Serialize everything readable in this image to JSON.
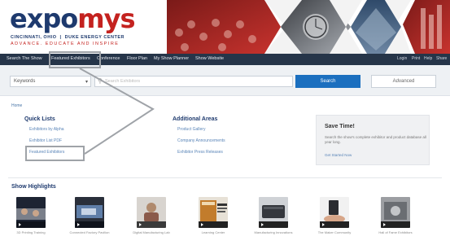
{
  "header": {
    "logo_part1": "expo",
    "logo_part2": "mys",
    "tagline_left": "CINCINNATI, OHIO",
    "tagline_right": "DUKE ENERGY CENTER",
    "tagline_sub": "ADVANCE. EDUCATE AND INSPIRE",
    "banner_image": "city-photo-collage"
  },
  "nav": {
    "items": [
      "Search The Show",
      "Featured Exhibitors",
      "Conference",
      "Floor Plan",
      "My Show Planner",
      "Show Website"
    ],
    "utility": [
      "Login",
      "Print",
      "Help",
      "Share"
    ]
  },
  "search": {
    "scope_value": "Keywords",
    "placeholder": "Search Exhibitors",
    "search_label": "Search",
    "advanced_label": "Advanced"
  },
  "breadcrumb": "Home",
  "quick_lists": {
    "title": "Quick Lists",
    "links": [
      "Exhibitors by Alpha",
      "Exhibitor List PDF",
      "Featured Exhibitors"
    ]
  },
  "additional_areas": {
    "title": "Additional Areas",
    "links": [
      "Product Gallery",
      "Company Announcements",
      "Exhibitor Press Releases"
    ]
  },
  "save_time": {
    "title": "Save Time!",
    "body": "Search the show's complete exhibitor and product database all year long.",
    "link": "Get Started Now"
  },
  "highlights": {
    "title": "Show Highlights",
    "items": [
      {
        "caption": "3D Printing Training",
        "icon": "conference-photo-thumb"
      },
      {
        "caption": "Connected Factory Pavilion",
        "icon": "video-thumb"
      },
      {
        "caption": "Digital Manufacturing Lab",
        "icon": "person-photo-thumb"
      },
      {
        "caption": "Learning Center",
        "icon": "3d-printed-book-thumb"
      },
      {
        "caption": "Manufacturing Innovations",
        "icon": "device-photo-thumb"
      },
      {
        "caption": "The Maker Community",
        "icon": "hand-device-thumb"
      },
      {
        "caption": "Hall of Fame Exhibitors",
        "icon": "machinery-photo-thumb"
      }
    ]
  },
  "colors": {
    "brand_blue": "#1e3a6e",
    "brand_red": "#c4221f",
    "nav_bg": "#263549",
    "button_blue": "#1b6fbf",
    "annotation_gray": "#9fa3a8"
  }
}
